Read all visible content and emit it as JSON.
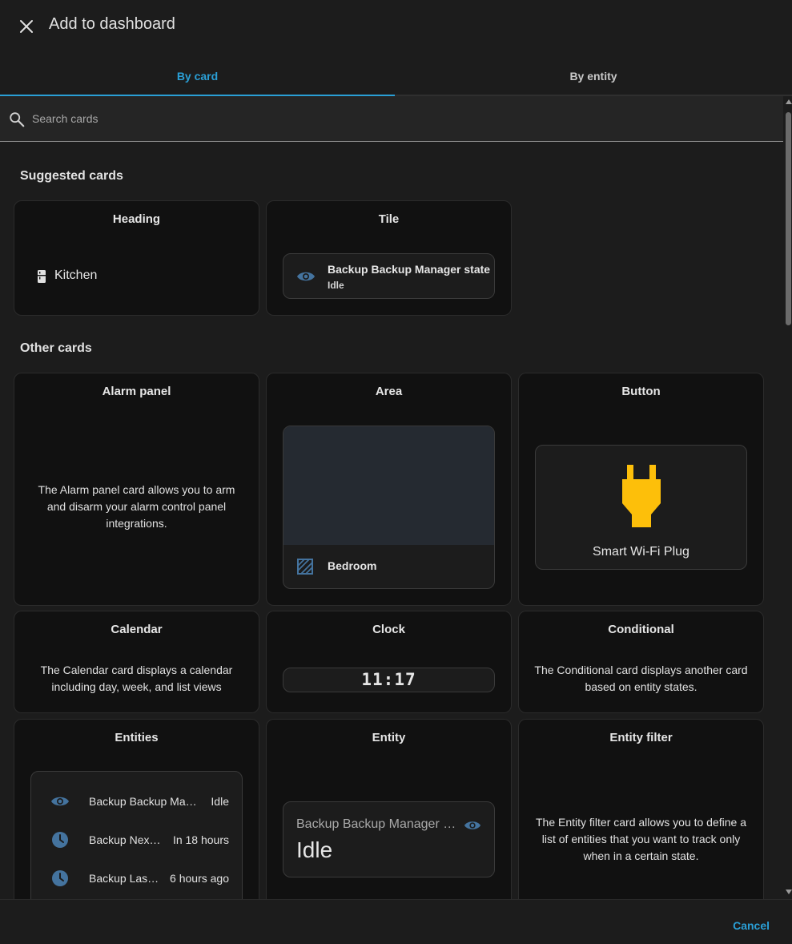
{
  "dialog": {
    "title": "Add to dashboard"
  },
  "tabs": [
    {
      "label": "By card"
    },
    {
      "label": "By entity"
    }
  ],
  "search": {
    "placeholder": "Search cards",
    "value": ""
  },
  "sections": {
    "suggested": "Suggested cards",
    "other": "Other cards"
  },
  "suggested_cards": {
    "heading": {
      "title": "Heading",
      "area_name": "Kitchen"
    },
    "tile": {
      "title": "Tile",
      "entity_name": "Backup Backup Manager state",
      "state": "Idle"
    }
  },
  "other_cards": {
    "alarm": {
      "title": "Alarm panel",
      "description": "The Alarm panel card allows you to arm and disarm your alarm control panel integrations."
    },
    "area": {
      "title": "Area",
      "area_name": "Bedroom"
    },
    "button": {
      "title": "Button",
      "entity_name": "Smart Wi-Fi Plug"
    },
    "calendar": {
      "title": "Calendar",
      "description": "The Calendar card displays a calendar including day, week, and list views"
    },
    "clock": {
      "title": "Clock",
      "time": "11:17"
    },
    "conditional": {
      "title": "Conditional",
      "description": "The Conditional card displays another card based on entity states."
    },
    "entities": {
      "title": "Entities",
      "rows": [
        {
          "name": "Backup Backup Manager state",
          "state": "Idle",
          "icon": "eye-icon"
        },
        {
          "name": "Backup Next scheduled automatic backup",
          "state": "In 18 hours",
          "icon": "clock-icon"
        },
        {
          "name": "Backup Last successful automatic backup",
          "state": "6 hours ago",
          "icon": "clock-icon"
        }
      ]
    },
    "entity": {
      "title": "Entity",
      "entity_name": "Backup Backup Manager state",
      "state": "Idle"
    },
    "entity_filter": {
      "title": "Entity filter",
      "description": "The Entity filter card allows you to define a list of entities that you want to track only when in a certain state."
    }
  },
  "footer": {
    "cancel_label": "Cancel"
  },
  "colors": {
    "accent": "#2a9fd6",
    "icon_blue": "#44739e",
    "plug_yellow": "#fdbf0a"
  }
}
